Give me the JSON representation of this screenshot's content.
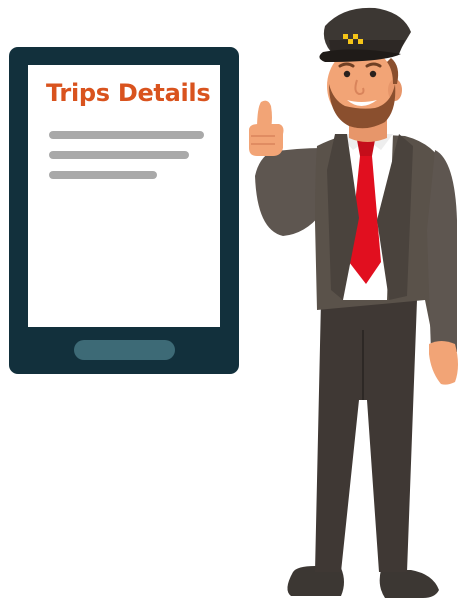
{
  "tablet": {
    "screen_title": "Trips Details"
  },
  "colors": {
    "title": "#d9531e",
    "tablet_frame": "#12303c",
    "home_button": "#3d6a76",
    "placeholder_lines": "#a9a9a9",
    "suit": "#5a524a",
    "tie": "#e10f1f"
  },
  "illustration": {
    "subject": "taxi-driver-thumbs-up-icon"
  }
}
